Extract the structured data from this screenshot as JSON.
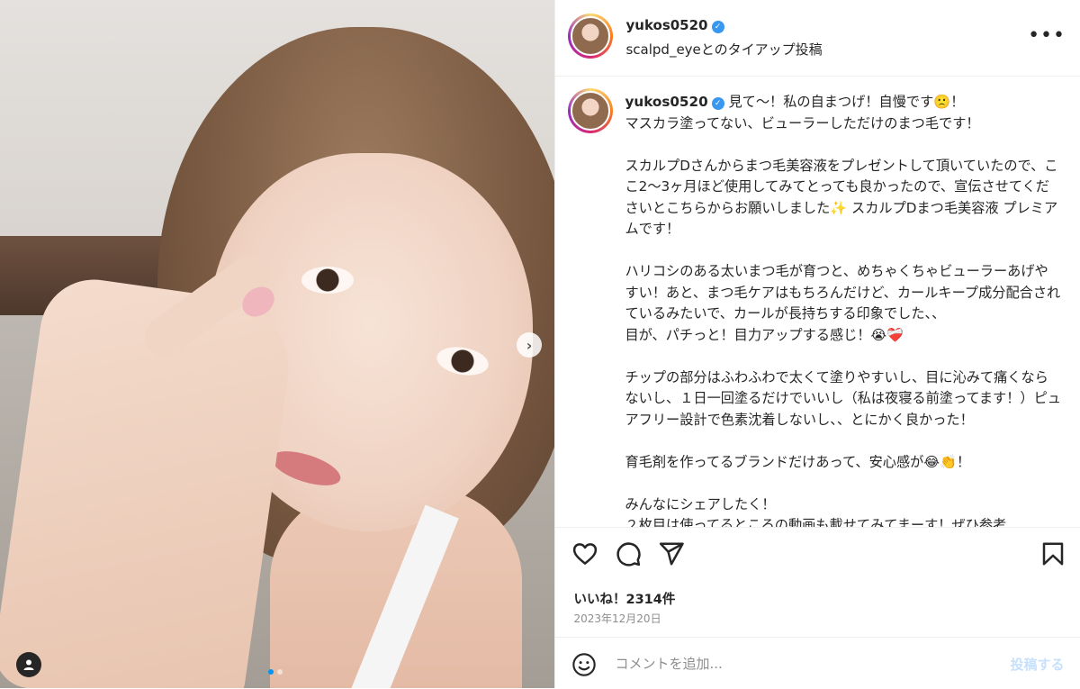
{
  "media": {
    "carousel_next_symbol": "›",
    "slide_count": 2,
    "active_slide": 1
  },
  "header": {
    "username": "yukos0520",
    "verified_symbol": "✓",
    "subtitle": "scalpd_eyeとのタイアップ投稿",
    "more_symbol": "•••"
  },
  "caption": {
    "username": "yukos0520",
    "verified_symbol": "✓",
    "text": " 見て〜！私の自まつげ！自慢です🙁！\nマスカラ塗ってない、ビューラーしただけのまつ毛です！\n\nスカルプDさんからまつ毛美容液をプレゼントして頂いていたので、ここ2〜3ヶ月ほど使用してみてとっても良かったので、宣伝させてくださいとこちらからお願いしました✨ スカルプDまつ毛美容液 プレミアムです！\n\nハリコシのある太いまつ毛が育つと、めちゃくちゃビューラーあげやすい！あと、まつ毛ケアはもちろんだけど、カールキープ成分配合されているみたいで、カールが長持ちする印象でした、、\n目が、パチっと！目力アップする感じ！😭❤️‍🩹\n\nチップの部分はふわふわで太くて塗りやすいし、目に沁みて痛くならないし、１日一回塗るだけでいいし（私は夜寝る前塗ってます！）ピュアフリー設計で色素沈着しないし、、とにかく良かった！\n\n育毛剤を作ってるブランドだけあって、安心感が😂👏！\n\nみんなにシェアしたく！\n２枚目は使ってるところの動画も載せてみてまーす！ぜひ参考"
  },
  "actions": {
    "likes": "いいね！2314件",
    "date": "2023年12月20日"
  },
  "comment": {
    "placeholder": "コメントを追加...",
    "post_label": "投稿する"
  },
  "colors": {
    "accent": "#0095f6",
    "verified": "#3897f0",
    "post_disabled": "#c7e1fc",
    "muted": "#8e8e8e"
  },
  "icons": [
    "heart-icon",
    "comment-icon",
    "share-icon",
    "bookmark-icon",
    "emoji-icon",
    "user-tag-icon"
  ]
}
